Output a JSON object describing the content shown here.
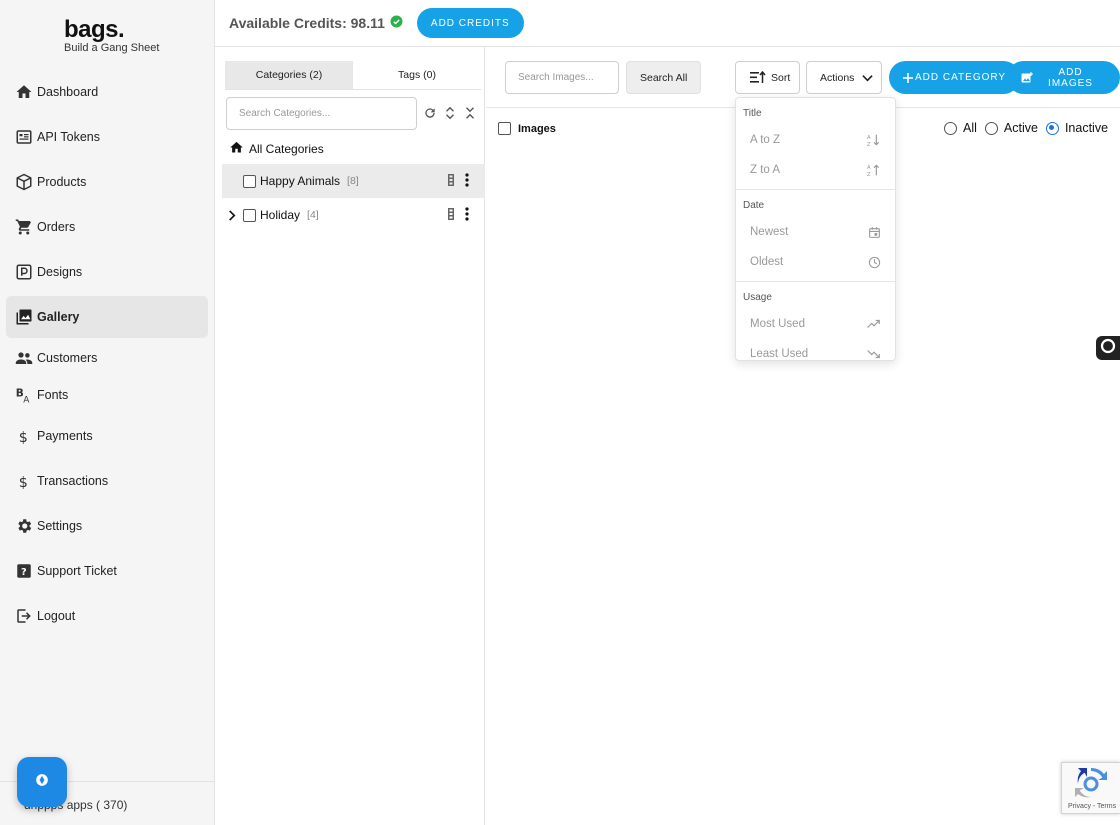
{
  "brand": {
    "name": "bags.",
    "tagline": "Build a Gang Sheet"
  },
  "sidebar": {
    "items": [
      {
        "label": "Dashboard",
        "icon": "home-icon"
      },
      {
        "label": "API Tokens",
        "icon": "token-icon"
      },
      {
        "label": "Products",
        "icon": "box-icon"
      },
      {
        "label": "Orders",
        "icon": "cart-icon"
      },
      {
        "label": "Designs",
        "icon": "designs-icon"
      },
      {
        "label": "Gallery",
        "icon": "gallery-icon",
        "active": true
      },
      {
        "label": "Customers",
        "icon": "people-icon"
      },
      {
        "label": "Fonts",
        "icon": "font-icon"
      },
      {
        "label": "Payments",
        "icon": "dollar-icon"
      },
      {
        "label": "Transactions",
        "icon": "dollar-icon"
      },
      {
        "label": "Settings",
        "icon": "gear-icon"
      },
      {
        "label": "Support Ticket",
        "icon": "help-icon"
      },
      {
        "label": "Logout",
        "icon": "logout-icon"
      }
    ],
    "footer": "drippps apps ( 370)"
  },
  "topbar": {
    "credits": "Available Credits: 98.11",
    "add_credits": "Add Credits"
  },
  "categories": {
    "tabs": [
      "Categories (2)",
      "Tags (0)"
    ],
    "search_placeholder": "Search Categories...",
    "all_label": "All Categories",
    "rows": [
      {
        "name": "Happy Animals",
        "count": "[8]"
      },
      {
        "name": "Holiday",
        "count": "[4]"
      }
    ]
  },
  "main": {
    "search_placeholder": "Search Images...",
    "search_all": "Search All",
    "sort": "Sort",
    "actions": "Actions",
    "add_category": "ADD CATEGORY",
    "add_images": "ADD IMAGES",
    "images_label": "Images",
    "filters": [
      "All",
      "Active",
      "Inactive"
    ],
    "selected_filter": "Inactive"
  },
  "sort_menu": {
    "sections": [
      {
        "title": "Title",
        "items": [
          {
            "label": "A to Z",
            "icon": "sort-az-icon"
          },
          {
            "label": "Z to A",
            "icon": "sort-za-icon"
          }
        ]
      },
      {
        "title": "Date",
        "items": [
          {
            "label": "Newest",
            "icon": "calendar-icon"
          },
          {
            "label": "Oldest",
            "icon": "clock-icon"
          }
        ]
      },
      {
        "title": "Usage",
        "items": [
          {
            "label": "Most Used",
            "icon": "trending-up-icon"
          },
          {
            "label": "Least Used",
            "icon": "trending-down-icon"
          }
        ]
      }
    ]
  },
  "recaptcha": {
    "links": "Privacy - Terms"
  },
  "colors": {
    "accent": "#17a2e8",
    "radio": "#1e6fe8",
    "success": "#2ab14a"
  }
}
